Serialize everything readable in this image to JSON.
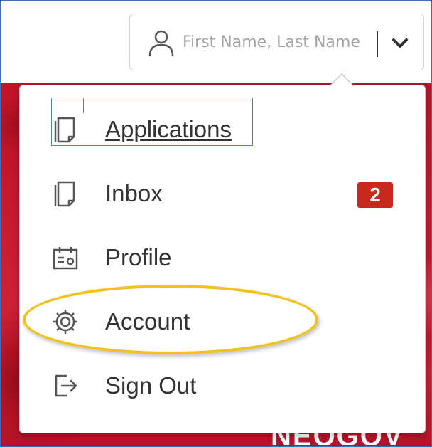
{
  "header": {
    "search": {
      "placeholder": "First Name, Last Name",
      "icon": "user-icon"
    },
    "dropdown_toggle_icon": "chevron-down-icon"
  },
  "menu": {
    "items": [
      {
        "label": "Applications",
        "icon": "document-icon",
        "focused": true
      },
      {
        "label": "Inbox",
        "icon": "document-icon",
        "badge": "2"
      },
      {
        "label": "Profile",
        "icon": "profile-card-icon"
      },
      {
        "label": "Account",
        "icon": "gear-icon",
        "highlighted": true
      },
      {
        "label": "Sign Out",
        "icon": "sign-out-icon"
      }
    ]
  },
  "background": {
    "brand_text": "NEOGOV"
  },
  "colors": {
    "badge": "#c9281d",
    "highlight_ring": "#f2c21a",
    "focus_outline": "#4a7fd4",
    "hero_red": "#c3142c"
  }
}
